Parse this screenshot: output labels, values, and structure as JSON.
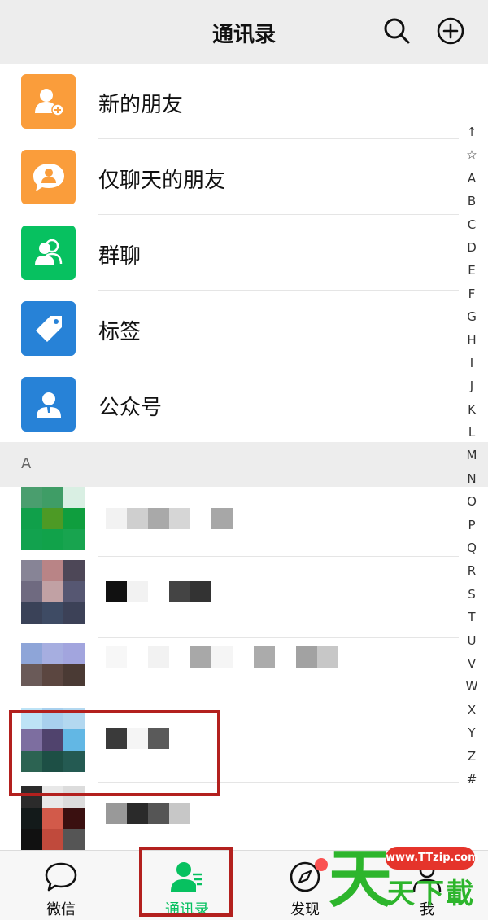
{
  "header": {
    "title": "通讯录",
    "search_icon": "search-icon",
    "add_icon": "add-circle-icon"
  },
  "function_items": [
    {
      "label": "新的朋友",
      "icon": "add-friend-icon",
      "color": "#fa9d3b"
    },
    {
      "label": "仅聊天的朋友",
      "icon": "chat-only-friend-icon",
      "color": "#fa9d3b"
    },
    {
      "label": "群聊",
      "icon": "group-chat-icon",
      "color": "#07c160"
    },
    {
      "label": "标签",
      "icon": "tag-icon",
      "color": "#2782d7"
    },
    {
      "label": "公众号",
      "icon": "official-account-icon",
      "color": "#2782d7"
    }
  ],
  "section": {
    "letter": "A"
  },
  "index_bar": [
    "↑",
    "☆",
    "A",
    "B",
    "C",
    "D",
    "E",
    "F",
    "G",
    "H",
    "I",
    "J",
    "K",
    "L",
    "M",
    "N",
    "O",
    "P",
    "Q",
    "R",
    "S",
    "T",
    "U",
    "V",
    "W",
    "X",
    "Y",
    "Z",
    "#"
  ],
  "tabs": [
    {
      "label": "微信",
      "icon": "chat-bubble-icon"
    },
    {
      "label": "通讯录",
      "icon": "contacts-icon",
      "active": true
    },
    {
      "label": "发现",
      "icon": "compass-icon",
      "badge": true
    },
    {
      "label": "我",
      "icon": "person-icon"
    }
  ],
  "watermark": {
    "url": "www.TTzip.com",
    "big": "天",
    "small": "天下載"
  },
  "colors": {
    "accent_green": "#07c160",
    "orange": "#fa9d3b",
    "blue": "#2782d7",
    "highlight_red": "#b3201e",
    "badge_red": "#fa5151"
  }
}
